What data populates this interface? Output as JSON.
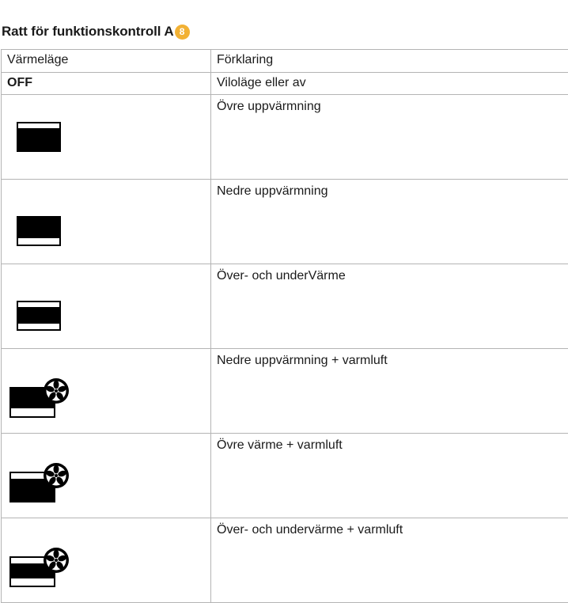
{
  "title": "Ratt för funktionskontroll A",
  "badge": "8",
  "table": {
    "headers": [
      "Värmeläge",
      "Förklaring"
    ],
    "off_row": {
      "mode": "OFF",
      "explanation": "Viloläge eller av"
    },
    "rows": [
      {
        "icon": "top-heat-icon",
        "explanation": "Övre uppvärmning"
      },
      {
        "icon": "bottom-heat-icon",
        "explanation": "Nedre uppvärmning"
      },
      {
        "icon": "top-bottom-heat-icon",
        "explanation": "Över- och underVärme"
      },
      {
        "icon": "bottom-heat-fan-icon",
        "explanation": "Nedre uppvärmning + varmluft"
      },
      {
        "icon": "top-heat-fan-icon",
        "explanation": "Övre värme + varmluft"
      },
      {
        "icon": "top-bottom-heat-fan-icon",
        "explanation": "Över- och undervärme + varmluft"
      }
    ]
  },
  "colors": {
    "badge": "#f2b134",
    "border": "#b4b4b4",
    "icon": "#000000"
  }
}
